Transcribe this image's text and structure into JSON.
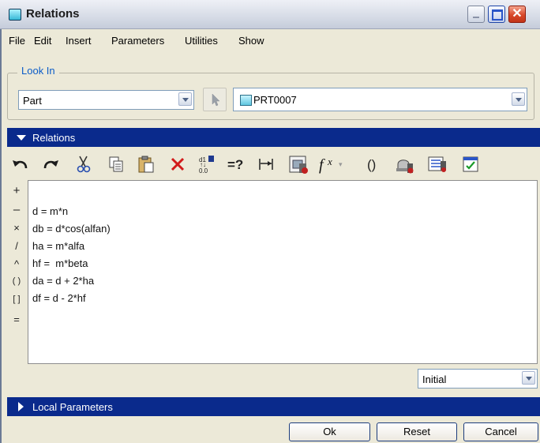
{
  "window": {
    "title": "Relations"
  },
  "menu": [
    "File",
    "Edit",
    "Insert",
    "Parameters",
    "Utilities",
    "Show"
  ],
  "look_in": {
    "legend": "Look In",
    "type_value": "Part",
    "model_value": "PRT0007"
  },
  "relations_section": {
    "label": "Relations"
  },
  "operators": [
    "+",
    "–",
    "×",
    "/",
    "^",
    "( )",
    "[ ]",
    "="
  ],
  "relations_lines": [
    "d = m*n",
    "db = d*cos(alfan)",
    "ha = m*alfa",
    "hf =  m*beta",
    "da = d + 2*ha",
    "df = d - 2*hf"
  ],
  "value_mode": "Initial",
  "local_parameters": {
    "label": "Local Parameters"
  },
  "buttons": {
    "ok": "Ok",
    "reset": "Reset",
    "cancel": "Cancel"
  },
  "toolbar_icons": [
    "undo-icon",
    "redo-icon",
    "cut-icon",
    "copy-icon",
    "paste-icon",
    "delete-icon",
    "display-values-icon",
    "evaluate-icon",
    "insert-dimension-icon",
    "insert-parameter-icon",
    "function-icon",
    "parentheses-icon",
    "verify-relations-icon",
    "sort-relations-icon",
    "checklist-icon"
  ],
  "colors": {
    "section_bar": "#0a2a8c",
    "legend_text": "#0b5cc8",
    "window_bg": "#ece9d8"
  }
}
